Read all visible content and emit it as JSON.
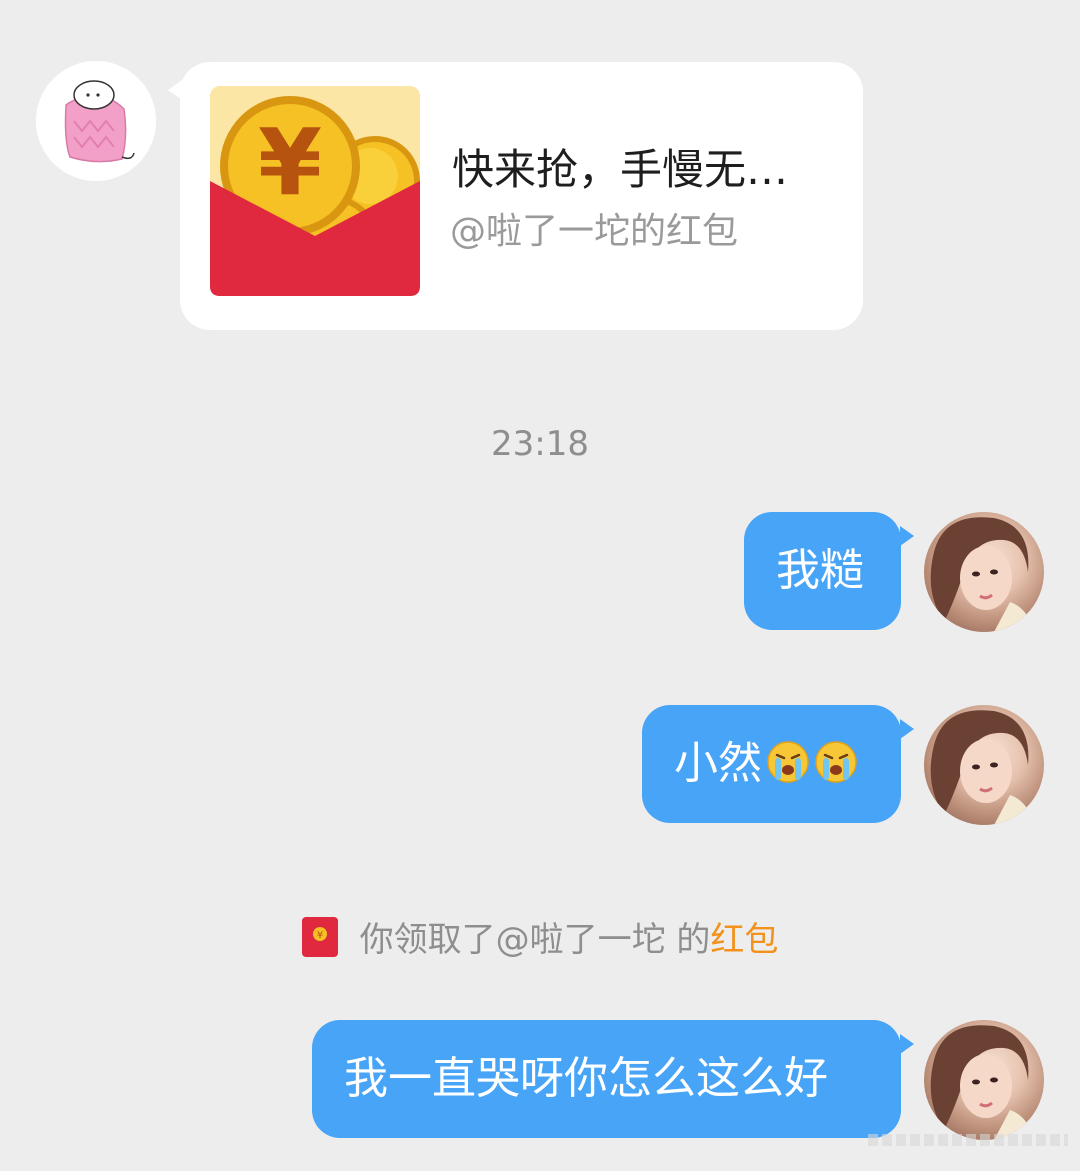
{
  "red_packet": {
    "title": "快来抢，手慢无…",
    "subtitle": "@啦了一坨的红包",
    "icon": "red-envelope-coins-icon"
  },
  "timestamp": "23:18",
  "messages": [
    {
      "text": "我糙",
      "emoji_count": 0
    },
    {
      "text": "小然",
      "emoji_count": 2,
      "emoji": "loudly-crying-face"
    },
    {
      "text": "我一直哭呀你怎么这么好",
      "emoji_count": 0
    }
  ],
  "notice": {
    "prefix": "你领取了@啦了一坨 的",
    "link": "红包",
    "icon": "red-envelope-icon"
  },
  "colors": {
    "background": "#ededed",
    "bubble": "#47a4f7",
    "link": "#f2921c",
    "red_envelope": "#e0283f",
    "coin": "#f6c124"
  }
}
